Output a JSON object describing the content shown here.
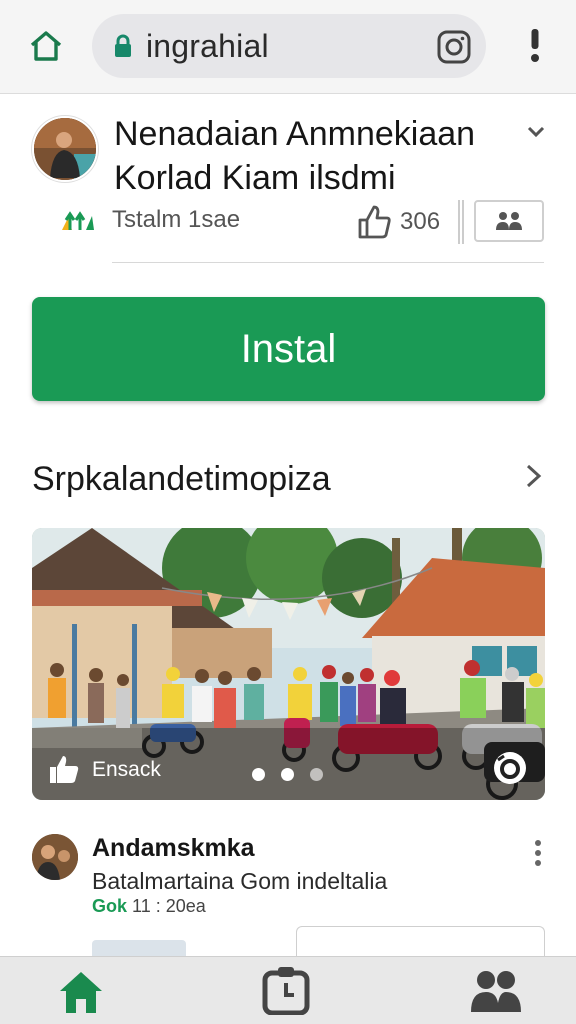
{
  "browser": {
    "url_text": "ingrahial",
    "icons": [
      "home-icon",
      "lock-icon",
      "camera-icon",
      "more-vert-icon"
    ]
  },
  "app": {
    "title": "Nenadaian Anmnekiaan Korlad Kiam ilsdmi",
    "meta_text": "Tstalm 1sae",
    "like_count": "306",
    "install_label": "Instal"
  },
  "section": {
    "title": "Srpkalandetimopiza"
  },
  "photo": {
    "caption": "Ensack",
    "carousel_total": 3,
    "carousel_active": 1
  },
  "post": {
    "name": "Andamskmka",
    "text": "Batalmartaina Gom indeltalia",
    "meta_highlight": "Gok",
    "meta_time": "11 : 20ea"
  },
  "colors": {
    "accent_green": "#1a9a55",
    "topbar_bg": "#f5f5f5",
    "urlbar_bg": "#e6e6e9",
    "bottom_nav_bg": "#e8e8e8"
  },
  "bottom_nav": {
    "icons": [
      "home-icon",
      "clipboard-icon",
      "people-icon"
    ],
    "active": "home-icon"
  }
}
